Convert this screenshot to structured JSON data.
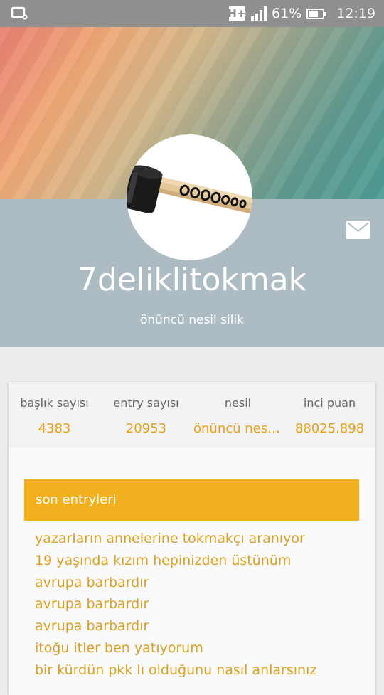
{
  "status_bar": {
    "network_type": "H+",
    "battery_percent": "61%",
    "battery_level": 0.61,
    "time": "12:19",
    "left_icon": "screen-cast-icon",
    "signal_icon": "signal-icon",
    "battery_icon": "battery-icon"
  },
  "profile": {
    "username": "7deliklitokmak",
    "subtitle": "önüncü nesil silik",
    "avatar_icon": "mallet-avatar",
    "message_icon": "mail-icon"
  },
  "stats": [
    {
      "label": "başlık sayısı",
      "value": "4383"
    },
    {
      "label": "entry sayısı",
      "value": "20953"
    },
    {
      "label": "nesil",
      "value": "önüncü nesi…"
    },
    {
      "label": "inci puan",
      "value": "88025.898"
    }
  ],
  "entries": {
    "title": "son entryleri",
    "items": [
      "yazarların annelerine tokmakçı aranıyor",
      "19 yaşında kızım hepinizden üstünüm",
      "avrupa barbardır",
      "avrupa barbardır",
      "avrupa barbardır",
      "itoğu itler ben yatıyorum",
      "bir kürdün pkk lı olduğunu nasıl anlarsınız"
    ]
  },
  "colors": {
    "accent": "#f2b01e",
    "link": "#d9a024",
    "profile_band": "#adbcc3",
    "status_bar": "#8f8f8f"
  }
}
